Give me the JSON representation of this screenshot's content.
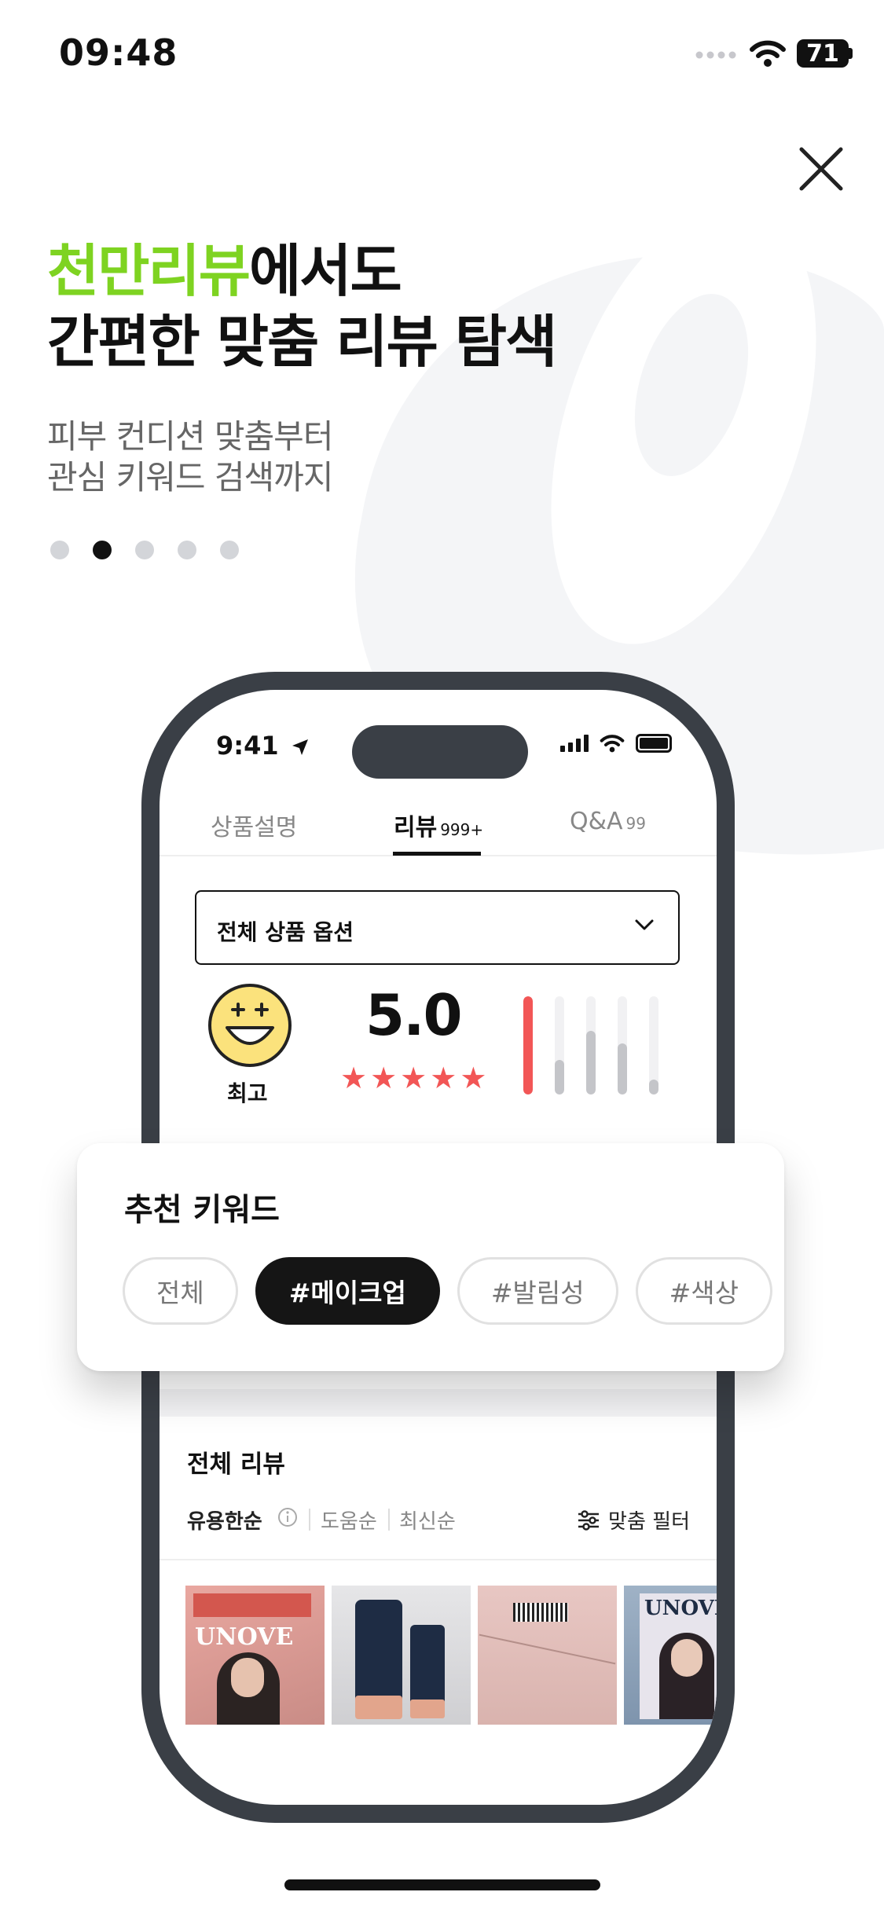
{
  "status_bar": {
    "time": "09:48",
    "battery": "71"
  },
  "headline": {
    "accent": "천만리뷰",
    "line1_rest": "에서도",
    "line2": "간편한 맞춤 리뷰 탐색"
  },
  "subtitle": {
    "line1": "피부 컨디션 맞춤부터",
    "line2": "관심 키워드 검색까지"
  },
  "pagination": {
    "total": 5,
    "active_index": 1
  },
  "phone": {
    "time": "9:41",
    "tabs": [
      {
        "label": "상품설명",
        "count": ""
      },
      {
        "label": "리뷰",
        "count": "999+"
      },
      {
        "label": "Q&A",
        "count": "99"
      }
    ],
    "option_select": "전체 상품 옵션",
    "rating_label": "최고",
    "score": "5.0",
    "stars": 5,
    "distribution": [
      1.0,
      0.35,
      0.65,
      0.52,
      0.15
    ],
    "all_reviews_title": "전체 리뷰",
    "sort": {
      "helpful": "유용한순",
      "helpful2": "도움순",
      "latest": "최신순"
    },
    "filter_label": "맞춤 필터",
    "thumb_brand": "UNOVE"
  },
  "keywords": {
    "title": "추천 키워드",
    "chips": [
      "전체",
      "#메이크업",
      "#발림성",
      "#색상"
    ],
    "active_index": 1
  },
  "colors": {
    "accent": "#7ed321",
    "star": "#f25656",
    "phone_frame": "#3a3f46"
  }
}
